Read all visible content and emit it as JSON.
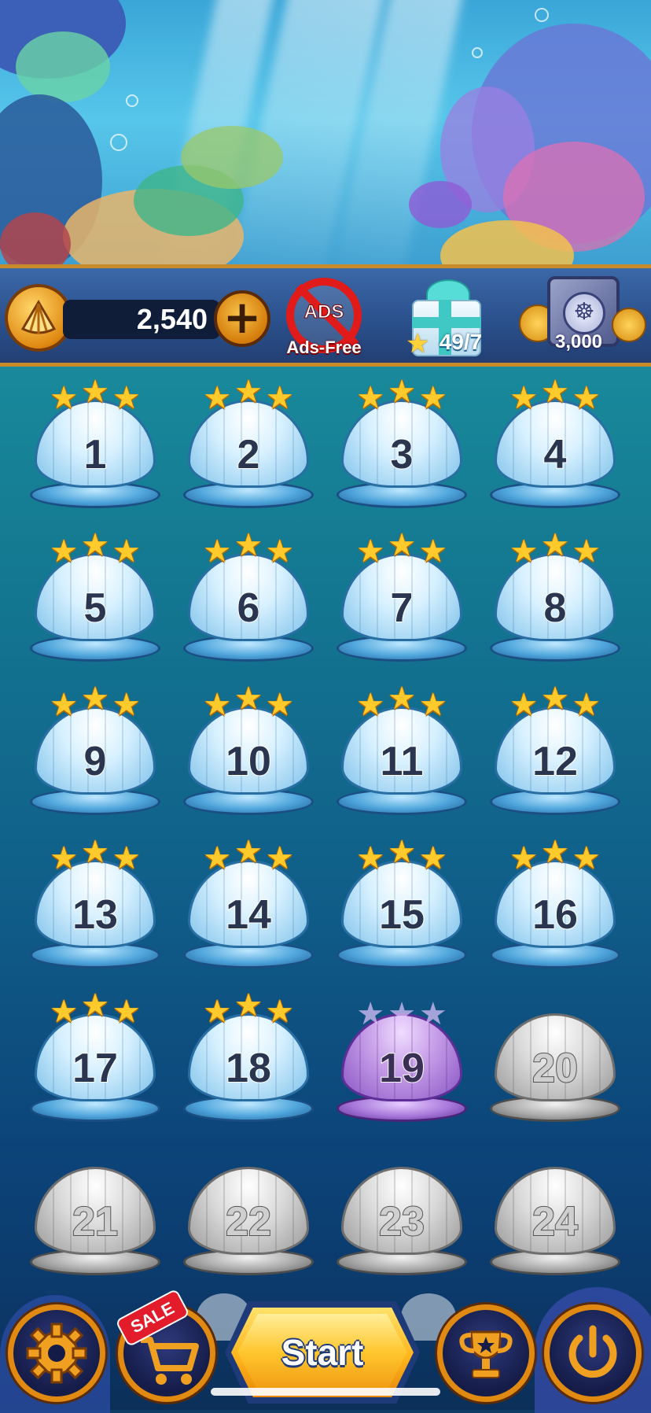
{
  "hud": {
    "coins": "2,540",
    "plus_label": "+",
    "ads_badge": "ADS",
    "ads_label": "Ads-Free",
    "gift_count": "49/7",
    "vault_count": "3,000"
  },
  "levels": [
    {
      "number": "1",
      "state": "completed",
      "stars": 3
    },
    {
      "number": "2",
      "state": "completed",
      "stars": 3
    },
    {
      "number": "3",
      "state": "completed",
      "stars": 3
    },
    {
      "number": "4",
      "state": "completed",
      "stars": 3
    },
    {
      "number": "5",
      "state": "completed",
      "stars": 3
    },
    {
      "number": "6",
      "state": "completed",
      "stars": 3
    },
    {
      "number": "7",
      "state": "completed",
      "stars": 3
    },
    {
      "number": "8",
      "state": "completed",
      "stars": 3
    },
    {
      "number": "9",
      "state": "completed",
      "stars": 3
    },
    {
      "number": "10",
      "state": "completed",
      "stars": 3
    },
    {
      "number": "11",
      "state": "completed",
      "stars": 3
    },
    {
      "number": "12",
      "state": "completed",
      "stars": 3
    },
    {
      "number": "13",
      "state": "completed",
      "stars": 3
    },
    {
      "number": "14",
      "state": "completed",
      "stars": 3
    },
    {
      "number": "15",
      "state": "completed",
      "stars": 3
    },
    {
      "number": "16",
      "state": "completed",
      "stars": 3
    },
    {
      "number": "17",
      "state": "completed",
      "stars": 3
    },
    {
      "number": "18",
      "state": "completed",
      "stars": 3
    },
    {
      "number": "19",
      "state": "current",
      "stars": 0
    },
    {
      "number": "20",
      "state": "locked",
      "stars": 0
    },
    {
      "number": "21",
      "state": "locked",
      "stars": 0
    },
    {
      "number": "22",
      "state": "locked",
      "stars": 0
    },
    {
      "number": "23",
      "state": "locked",
      "stars": 0
    },
    {
      "number": "24",
      "state": "locked",
      "stars": 0
    }
  ],
  "bottom": {
    "sale_tag": "SALE",
    "start_label": "Start",
    "icons": [
      "gear-icon",
      "cart-icon",
      "trophy-icon",
      "power-icon"
    ]
  },
  "colors": {
    "accent_gold": "#e08a12",
    "star": "#ffcb2c",
    "hud_blue": "#2a4f8a",
    "sale_red": "#e21c2a"
  }
}
